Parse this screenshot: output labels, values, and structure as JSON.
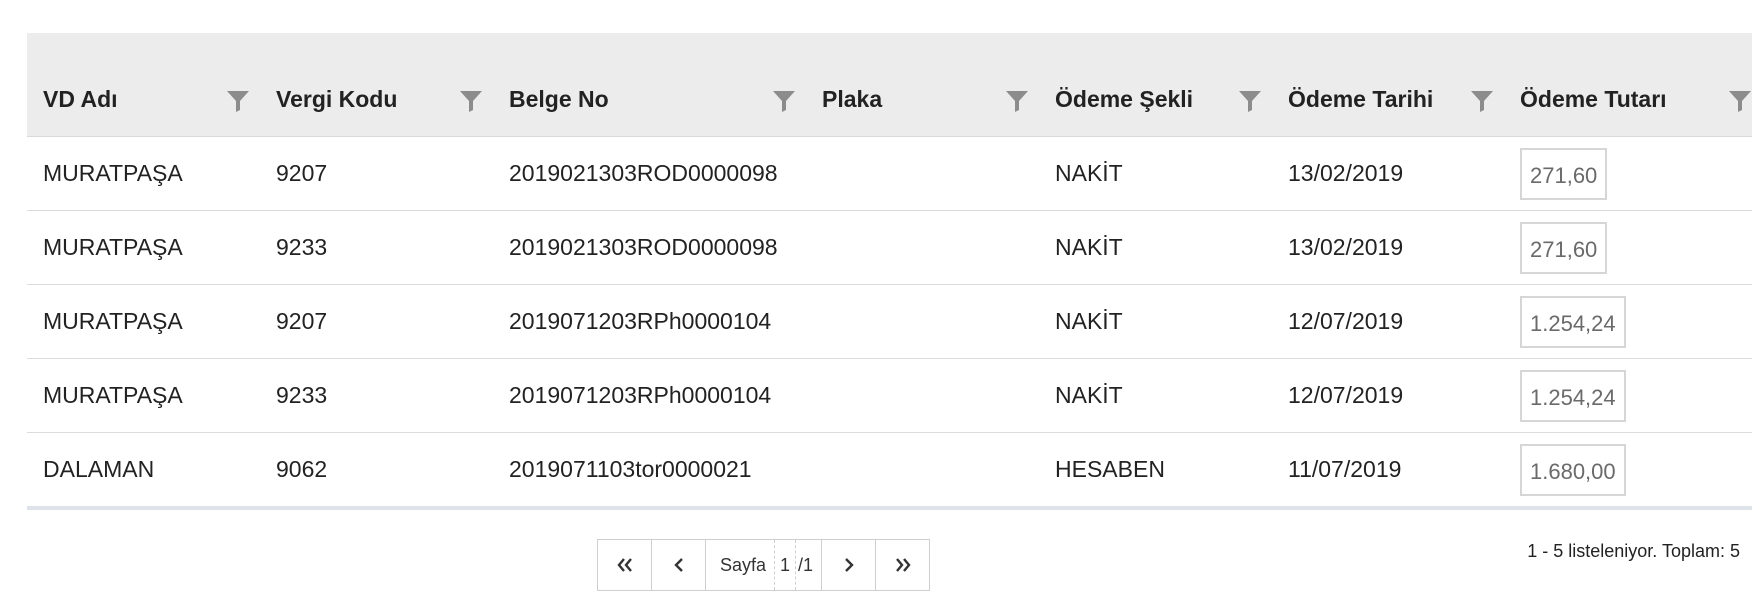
{
  "grid": {
    "columns": [
      "VD Adı",
      "Vergi Kodu",
      "Belge No",
      "Plaka",
      "Ödeme Şekli",
      "Ödeme Tarihi",
      "Ödeme Tutarı"
    ],
    "rows": [
      {
        "vd_adi": "MURATPAŞA",
        "vergi_kodu": "9207",
        "belge_no": "2019021303ROD0000098",
        "plaka": "",
        "odeme_sekli": "NAKİT",
        "odeme_tarihi": "13/02/2019",
        "odeme_tutari": "271,60"
      },
      {
        "vd_adi": "MURATPAŞA",
        "vergi_kodu": "9233",
        "belge_no": "2019021303ROD0000098",
        "plaka": "",
        "odeme_sekli": "NAKİT",
        "odeme_tarihi": "13/02/2019",
        "odeme_tutari": "271,60"
      },
      {
        "vd_adi": "MURATPAŞA",
        "vergi_kodu": "9207",
        "belge_no": "2019071203RPh0000104",
        "plaka": "",
        "odeme_sekli": "NAKİT",
        "odeme_tarihi": "12/07/2019",
        "odeme_tutari": "1.254,24"
      },
      {
        "vd_adi": "MURATPAŞA",
        "vergi_kodu": "9233",
        "belge_no": "2019071203RPh0000104",
        "plaka": "",
        "odeme_sekli": "NAKİT",
        "odeme_tarihi": "12/07/2019",
        "odeme_tutari": "1.254,24"
      },
      {
        "vd_adi": "DALAMAN",
        "vergi_kodu": "9062",
        "belge_no": "2019071103tor0000021",
        "plaka": "",
        "odeme_sekli": "HESABEN",
        "odeme_tarihi": "11/07/2019",
        "odeme_tutari": "1.680,00"
      }
    ]
  },
  "pager": {
    "first_icon": "double-chevron-left-icon",
    "prev_icon": "chevron-left-icon",
    "next_icon": "chevron-right-icon",
    "last_icon": "double-chevron-right-icon",
    "page_label": "Sayfa",
    "page_value": "1",
    "total_pages": "/1"
  },
  "status_text": "1 - 5 listeleniyor. Toplam: 5",
  "colors": {
    "header_bg": "#ececec",
    "border": "#dcdcdc"
  }
}
